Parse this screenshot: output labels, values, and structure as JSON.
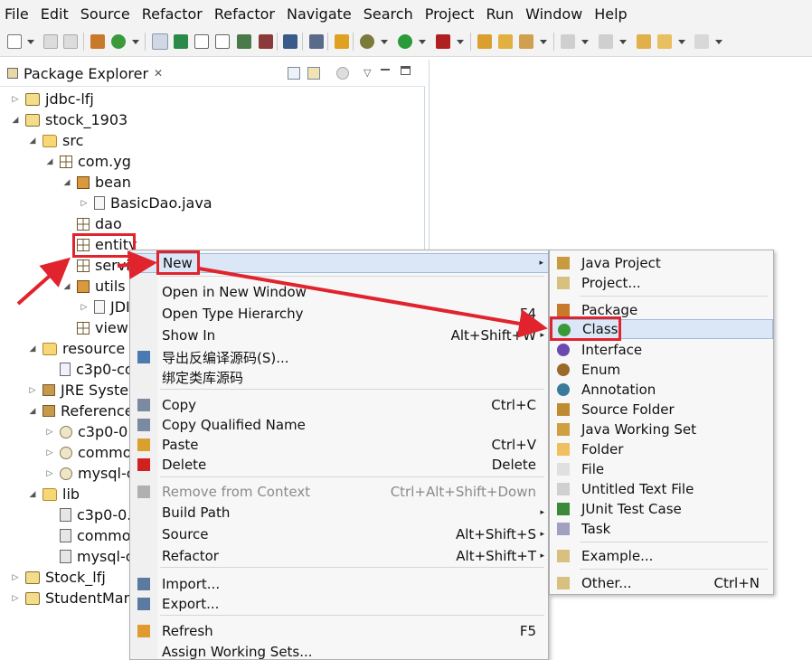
{
  "menubar": [
    "File",
    "Edit",
    "Source",
    "Refactor",
    "Refactor",
    "Navigate",
    "Search",
    "Project",
    "Run",
    "Window",
    "Help"
  ],
  "explorer": {
    "title": "Package Explorer",
    "close": "✕",
    "tree": [
      {
        "label": "jdbc-lfj",
        "twisty": "▷",
        "icon": "proj",
        "icon_name": "project-icon"
      },
      {
        "label": "stock_1903",
        "twisty": "◢",
        "icon": "proj",
        "icon_name": "project-icon"
      },
      {
        "label": "src",
        "twisty": "◢",
        "icon": "folder",
        "icon_name": "source-folder-icon"
      },
      {
        "label": "com.yg",
        "twisty": "◢",
        "icon": "pkg",
        "icon_name": "package-icon"
      },
      {
        "label": "bean",
        "twisty": "◢",
        "icon": "pkgfull",
        "icon_name": "package-icon"
      },
      {
        "label": "BasicDao.java",
        "twisty": "▷",
        "icon": "java",
        "icon_name": "java-file-icon"
      },
      {
        "label": "dao",
        "twisty": "",
        "icon": "pkg",
        "icon_name": "package-icon"
      },
      {
        "label": "entity",
        "twisty": "",
        "icon": "pkg",
        "icon_name": "package-icon"
      },
      {
        "label": "servic",
        "twisty": "",
        "icon": "pkg",
        "icon_name": "package-icon"
      },
      {
        "label": "utils",
        "twisty": "◢",
        "icon": "pkgfull",
        "icon_name": "package-icon"
      },
      {
        "label": "JDI",
        "twisty": "▷",
        "icon": "java",
        "icon_name": "java-file-icon"
      },
      {
        "label": "view",
        "twisty": "",
        "icon": "pkg",
        "icon_name": "package-icon"
      },
      {
        "label": "resource",
        "twisty": "◢",
        "icon": "folder",
        "icon_name": "source-folder-icon"
      },
      {
        "label": "c3p0-co",
        "twisty": "",
        "icon": "xml",
        "icon_name": "xml-file-icon"
      },
      {
        "label": "JRE System",
        "twisty": "▷",
        "icon": "lib",
        "icon_name": "library-icon"
      },
      {
        "label": "Referenced",
        "twisty": "◢",
        "icon": "lib",
        "icon_name": "library-icon"
      },
      {
        "label": "c3p0-0.9",
        "twisty": "▷",
        "icon": "jar",
        "icon_name": "jar-icon"
      },
      {
        "label": "commo",
        "twisty": "▷",
        "icon": "jar",
        "icon_name": "jar-icon"
      },
      {
        "label": "mysql-c",
        "twisty": "▷",
        "icon": "jar",
        "icon_name": "jar-icon"
      },
      {
        "label": "lib",
        "twisty": "◢",
        "icon": "folder",
        "icon_name": "folder-icon"
      },
      {
        "label": "c3p0-0.9",
        "twisty": "",
        "icon": "jarfile",
        "icon_name": "jar-file-icon"
      },
      {
        "label": "commo",
        "twisty": "",
        "icon": "jarfile",
        "icon_name": "jar-file-icon"
      },
      {
        "label": "mysql-c",
        "twisty": "",
        "icon": "jarfile",
        "icon_name": "jar-file-icon"
      },
      {
        "label": "Stock_lfj",
        "twisty": "▷",
        "icon": "proj",
        "icon_name": "project-icon"
      },
      {
        "label": "StudentMana",
        "twisty": "▷",
        "icon": "proj",
        "icon_name": "project-icon"
      }
    ]
  },
  "context_menu": {
    "items": [
      {
        "label": "New",
        "accel": "",
        "sub": true,
        "icon": "",
        "disabled": false,
        "hl": true
      },
      {
        "label": "Open in New Window",
        "accel": "",
        "sub": false,
        "icon": ""
      },
      {
        "label": "Open Type Hierarchy",
        "accel": "F4",
        "sub": false,
        "icon": ""
      },
      {
        "label": "Show In",
        "accel": "Alt+Shift+W",
        "sub": true,
        "icon": ""
      },
      {
        "label": "导出反编译源码(S)...",
        "accel": "",
        "sub": false,
        "icon": "export-source-icon"
      },
      {
        "label": "绑定类库源码",
        "accel": "",
        "sub": false,
        "icon": ""
      },
      {
        "label": "Copy",
        "accel": "Ctrl+C",
        "sub": false,
        "icon": "copy-icon"
      },
      {
        "label": "Copy Qualified Name",
        "accel": "",
        "sub": false,
        "icon": "copy-qualified-icon"
      },
      {
        "label": "Paste",
        "accel": "Ctrl+V",
        "sub": false,
        "icon": "paste-icon"
      },
      {
        "label": "Delete",
        "accel": "Delete",
        "sub": false,
        "icon": "delete-icon"
      },
      {
        "label": "Remove from Context",
        "accel": "Ctrl+Alt+Shift+Down",
        "sub": false,
        "icon": "remove-context-icon",
        "disabled": true
      },
      {
        "label": "Build Path",
        "accel": "",
        "sub": true,
        "icon": ""
      },
      {
        "label": "Source",
        "accel": "Alt+Shift+S",
        "sub": true,
        "icon": ""
      },
      {
        "label": "Refactor",
        "accel": "Alt+Shift+T",
        "sub": true,
        "icon": ""
      },
      {
        "label": "Import...",
        "accel": "",
        "sub": false,
        "icon": "import-icon"
      },
      {
        "label": "Export...",
        "accel": "",
        "sub": false,
        "icon": "export-icon"
      },
      {
        "label": "Refresh",
        "accel": "F5",
        "sub": false,
        "icon": "refresh-icon"
      },
      {
        "label": "Assign Working Sets...",
        "accel": "",
        "sub": false,
        "icon": ""
      }
    ]
  },
  "submenu": {
    "items": [
      {
        "label": "Java Project",
        "accel": "",
        "icon": "java-project-icon"
      },
      {
        "label": "Project...",
        "accel": "",
        "icon": "project-wizard-icon"
      },
      {
        "label": "Package",
        "accel": "",
        "icon": "package-icon"
      },
      {
        "label": "Class",
        "accel": "",
        "icon": "class-icon",
        "hl": true
      },
      {
        "label": "Interface",
        "accel": "",
        "icon": "interface-icon"
      },
      {
        "label": "Enum",
        "accel": "",
        "icon": "enum-icon"
      },
      {
        "label": "Annotation",
        "accel": "",
        "icon": "annotation-icon"
      },
      {
        "label": "Source Folder",
        "accel": "",
        "icon": "source-folder-icon"
      },
      {
        "label": "Java Working Set",
        "accel": "",
        "icon": "working-set-icon"
      },
      {
        "label": "Folder",
        "accel": "",
        "icon": "folder-icon"
      },
      {
        "label": "File",
        "accel": "",
        "icon": "file-icon"
      },
      {
        "label": "Untitled Text File",
        "accel": "",
        "icon": "text-file-icon"
      },
      {
        "label": "JUnit Test Case",
        "accel": "",
        "icon": "junit-icon"
      },
      {
        "label": "Task",
        "accel": "",
        "icon": "task-icon"
      },
      {
        "label": "Example...",
        "accel": "",
        "icon": "example-icon"
      },
      {
        "label": "Other...",
        "accel": "Ctrl+N",
        "icon": "other-wizard-icon"
      }
    ]
  }
}
